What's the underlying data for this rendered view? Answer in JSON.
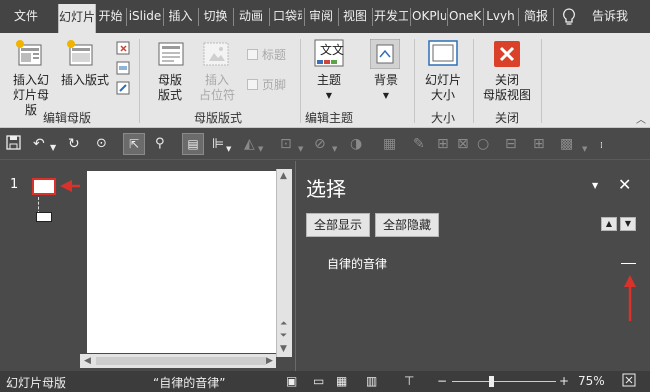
{
  "ribbon_tabs": [
    {
      "label": "文件",
      "active": false
    },
    {
      "label": "幻灯片母版",
      "active": true
    },
    {
      "label": "开始",
      "active": false
    },
    {
      "label": "iSlide",
      "active": false
    },
    {
      "label": "插入",
      "active": false
    },
    {
      "label": "切换",
      "active": false
    },
    {
      "label": "动画",
      "active": false
    },
    {
      "label": "口袋动画",
      "active": false
    },
    {
      "label": "审阅",
      "active": false
    },
    {
      "label": "视图",
      "active": false
    },
    {
      "label": "开发工具",
      "active": false
    },
    {
      "label": "OKPlus",
      "active": false
    },
    {
      "label": "OneKey",
      "active": false
    },
    {
      "label": "Lvyh",
      "active": false
    },
    {
      "label": "简报",
      "active": false
    },
    {
      "label": "告诉我",
      "active": false
    }
  ],
  "ribbon": {
    "edit_master": {
      "label": "编辑母版",
      "insert_slide_master_l1": "插入幻",
      "insert_slide_master_l2": "灯片母版",
      "insert_layout": "插入版式"
    },
    "master_layout": {
      "label": "母版版式",
      "master_layout_l1": "母版",
      "master_layout_l2": "版式",
      "insert_placeholder_l1": "插入",
      "insert_placeholder_l2": "占位符",
      "title": "标题",
      "footer": "页脚"
    },
    "edit_theme": {
      "label": "编辑主题",
      "theme": "主题",
      "theme_icon_text": "文文",
      "background": "背景"
    },
    "size": {
      "label": "大小",
      "slide_size_l1": "幻灯片",
      "slide_size_l2": "大小"
    },
    "close": {
      "label": "关闭",
      "close_master_view_l1": "关闭",
      "close_master_view_l2": "母版视图"
    }
  },
  "thumbnails": {
    "slide_number": "1"
  },
  "selection_pane": {
    "title": "选择",
    "show_all": "全部显示",
    "hide_all": "全部隐藏",
    "items": [
      {
        "name": "自律的音律",
        "visibility_glyph": "—"
      }
    ]
  },
  "status_bar": {
    "view": "幻灯片母版",
    "theme_name": "“自律的音律”",
    "zoom": "75%"
  },
  "colors": {
    "accent_red": "#d9322a",
    "ribbon_bg": "#e6e6e6",
    "dark_bg": "#4a4a4a"
  }
}
